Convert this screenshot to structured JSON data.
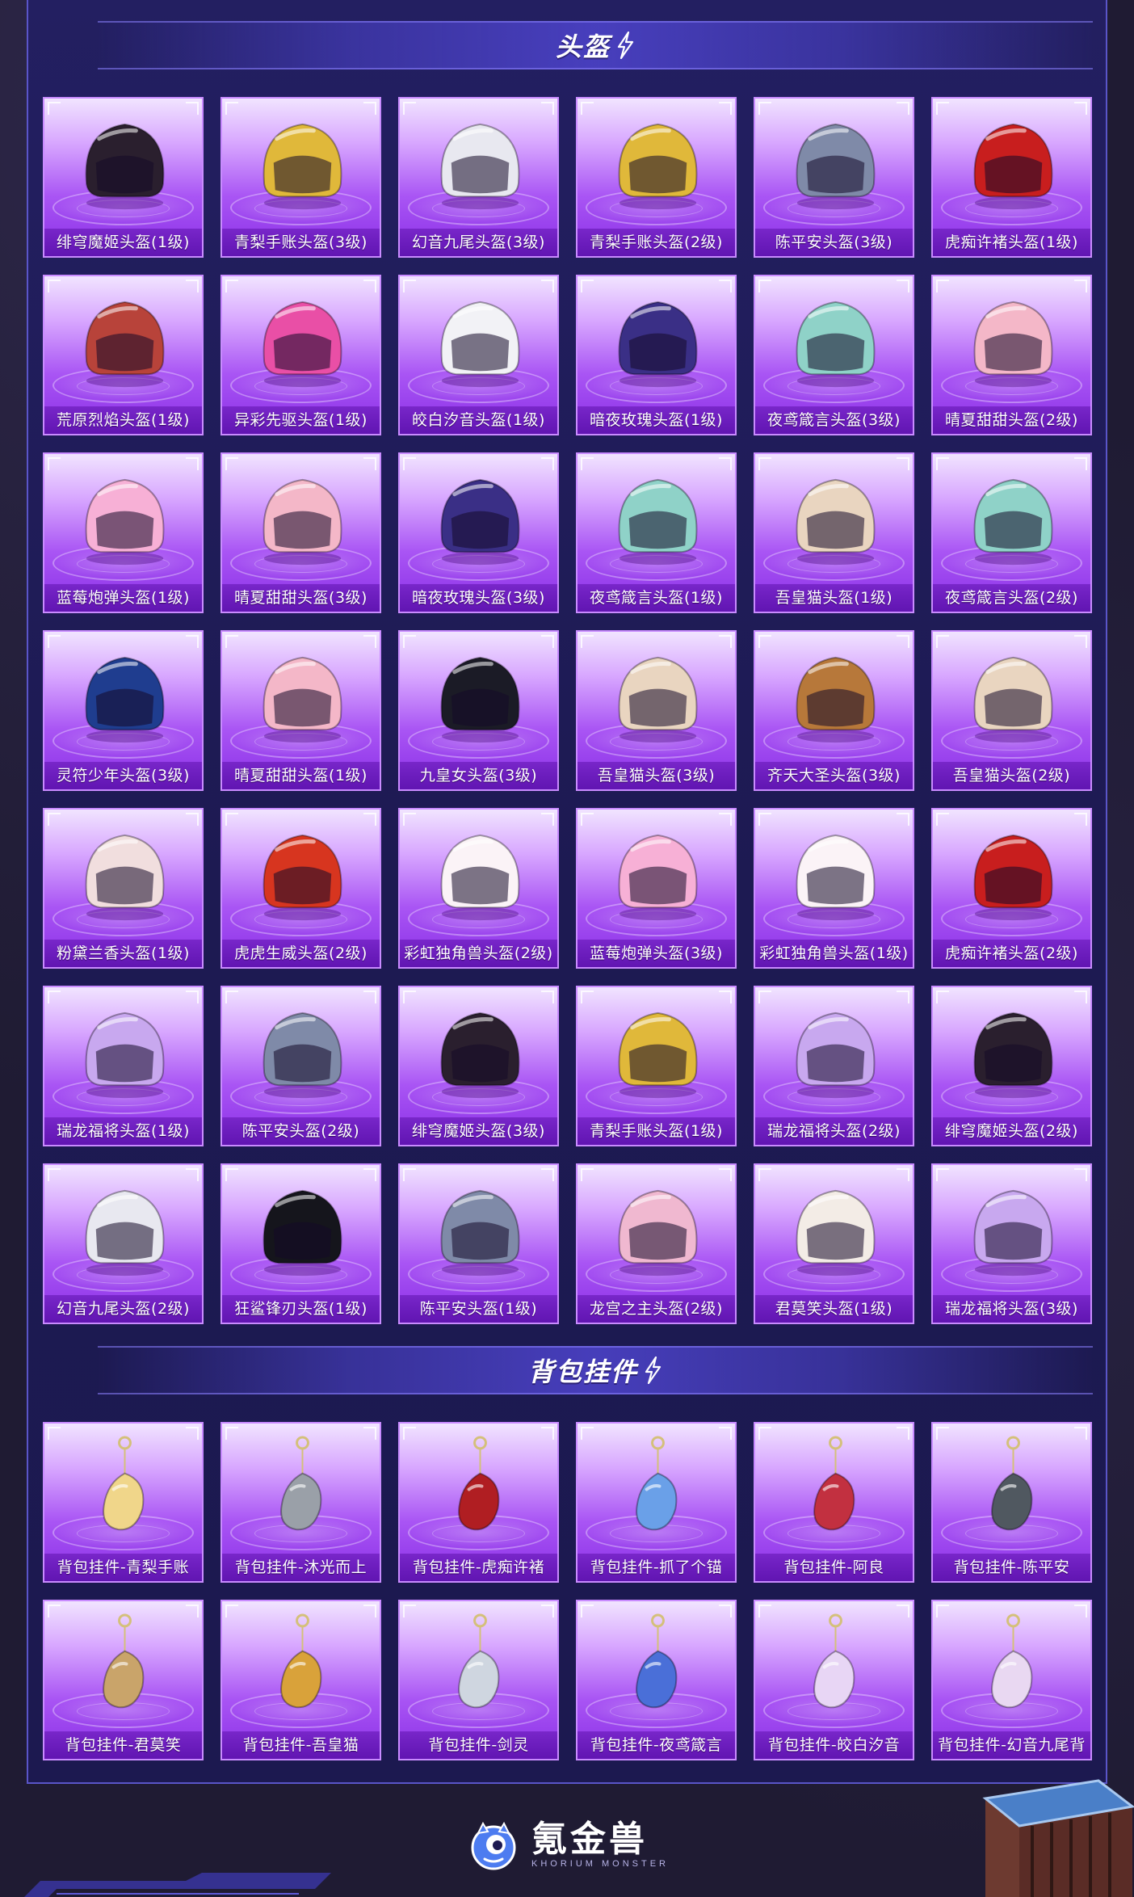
{
  "sections": [
    {
      "title": "头盔",
      "items": [
        {
          "label": "绯穹魔姬头盔(1级)",
          "icon": "helmet-icon",
          "color": "#2a1f2e"
        },
        {
          "label": "青梨手账头盔(3级)",
          "icon": "helmet-icon",
          "color": "#e0b83a"
        },
        {
          "label": "幻音九尾头盔(3级)",
          "icon": "helmet-icon",
          "color": "#e8e8f0"
        },
        {
          "label": "青梨手账头盔(2级)",
          "icon": "helmet-icon",
          "color": "#e0b83a"
        },
        {
          "label": "陈平安头盔(3级)",
          "icon": "helmet-icon",
          "color": "#7f8aa8"
        },
        {
          "label": "虎痴许褚头盔(1级)",
          "icon": "helmet-icon",
          "color": "#c81e1e"
        },
        {
          "label": "荒原烈焰头盔(1级)",
          "icon": "helmet-icon",
          "color": "#b8433a"
        },
        {
          "label": "异彩先驱头盔(1级)",
          "icon": "helmet-icon",
          "color": "#e94fa6"
        },
        {
          "label": "皎白汐音头盔(1级)",
          "icon": "helmet-icon",
          "color": "#f2f2f6"
        },
        {
          "label": "暗夜玫瑰头盔(1级)",
          "icon": "helmet-icon",
          "color": "#3a2f86"
        },
        {
          "label": "夜鸢箴言头盔(3级)",
          "icon": "helmet-icon",
          "color": "#8fd2c8"
        },
        {
          "label": "晴夏甜甜头盔(2级)",
          "icon": "helmet-icon",
          "color": "#f4b7c8"
        },
        {
          "label": "蓝莓炮弹头盔(1级)",
          "icon": "helmet-icon",
          "color": "#f7b0d6"
        },
        {
          "label": "晴夏甜甜头盔(3级)",
          "icon": "helmet-icon",
          "color": "#f4b7c8"
        },
        {
          "label": "暗夜玫瑰头盔(3级)",
          "icon": "helmet-icon",
          "color": "#3a2f86"
        },
        {
          "label": "夜鸢箴言头盔(1级)",
          "icon": "helmet-icon",
          "color": "#8fd2c8"
        },
        {
          "label": "吾皇猫头盔(1级)",
          "icon": "helmet-icon",
          "color": "#e9d5c0"
        },
        {
          "label": "夜鸢箴言头盔(2级)",
          "icon": "helmet-icon",
          "color": "#8fd2c8"
        },
        {
          "label": "灵符少年头盔(3级)",
          "icon": "helmet-icon",
          "color": "#1f3d8f"
        },
        {
          "label": "晴夏甜甜头盔(1级)",
          "icon": "helmet-icon",
          "color": "#f4b7c8"
        },
        {
          "label": "九皇女头盔(3级)",
          "icon": "helmet-icon",
          "color": "#1b1b26"
        },
        {
          "label": "吾皇猫头盔(3级)",
          "icon": "helmet-icon",
          "color": "#e9d5c0"
        },
        {
          "label": "齐天大圣头盔(3级)",
          "icon": "helmet-icon",
          "color": "#b7783a"
        },
        {
          "label": "吾皇猫头盔(2级)",
          "icon": "helmet-icon",
          "color": "#e9d5c0"
        },
        {
          "label": "粉黛兰香头盔(1级)",
          "icon": "helmet-icon",
          "color": "#f1dede"
        },
        {
          "label": "虎虎生威头盔(2级)",
          "icon": "helmet-icon",
          "color": "#d7351f"
        },
        {
          "label": "彩虹独角兽头盔(2级)",
          "icon": "helmet-icon",
          "color": "#fbf3f7"
        },
        {
          "label": "蓝莓炮弹头盔(3级)",
          "icon": "helmet-icon",
          "color": "#f7b0d6"
        },
        {
          "label": "彩虹独角兽头盔(1级)",
          "icon": "helmet-icon",
          "color": "#fbf3f7"
        },
        {
          "label": "虎痴许褚头盔(2级)",
          "icon": "helmet-icon",
          "color": "#c81e1e"
        },
        {
          "label": "瑞龙福将头盔(1级)",
          "icon": "helmet-icon",
          "color": "#c8a8ef"
        },
        {
          "label": "陈平安头盔(2级)",
          "icon": "helmet-icon",
          "color": "#7f8aa8"
        },
        {
          "label": "绯穹魔姬头盔(3级)",
          "icon": "helmet-icon",
          "color": "#2a1f2e"
        },
        {
          "label": "青梨手账头盔(1级)",
          "icon": "helmet-icon",
          "color": "#e0b83a"
        },
        {
          "label": "瑞龙福将头盔(2级)",
          "icon": "helmet-icon",
          "color": "#c8a8ef"
        },
        {
          "label": "绯穹魔姬头盔(2级)",
          "icon": "helmet-icon",
          "color": "#2a1f2e"
        },
        {
          "label": "幻音九尾头盔(2级)",
          "icon": "helmet-icon",
          "color": "#e8e8f0"
        },
        {
          "label": "狂鲨锋刃头盔(1级)",
          "icon": "helmet-icon",
          "color": "#15151c"
        },
        {
          "label": "陈平安头盔(1级)",
          "icon": "helmet-icon",
          "color": "#7f8aa8"
        },
        {
          "label": "龙宫之主头盔(2级)",
          "icon": "helmet-icon",
          "color": "#f0b8d0"
        },
        {
          "label": "君莫笑头盔(1级)",
          "icon": "helmet-icon",
          "color": "#f3ece6"
        },
        {
          "label": "瑞龙福将头盔(3级)",
          "icon": "helmet-icon",
          "color": "#c8a8ef"
        }
      ]
    },
    {
      "title": "背包挂件",
      "items": [
        {
          "label": "背包挂件-青梨手账",
          "icon": "pendant-icon",
          "color": "#f0d68a"
        },
        {
          "label": "背包挂件-沐光而上",
          "icon": "pendant-icon",
          "color": "#9aa0a8"
        },
        {
          "label": "背包挂件-虎痴许褚",
          "icon": "pendant-icon",
          "color": "#b01e22"
        },
        {
          "label": "背包挂件-抓了个锚",
          "icon": "pendant-icon",
          "color": "#6aa0e8"
        },
        {
          "label": "背包挂件-阿良",
          "icon": "pendant-icon",
          "color": "#c23040"
        },
        {
          "label": "背包挂件-陈平安",
          "icon": "pendant-icon",
          "color": "#505860"
        },
        {
          "label": "背包挂件-君莫笑",
          "icon": "pendant-icon",
          "color": "#c9a46a"
        },
        {
          "label": "背包挂件-吾皇猫",
          "icon": "pendant-icon",
          "color": "#d9a23a"
        },
        {
          "label": "背包挂件-剑灵",
          "icon": "pendant-icon",
          "color": "#cfd6e0"
        },
        {
          "label": "背包挂件-夜鸢箴言",
          "icon": "pendant-icon",
          "color": "#4a6fd8"
        },
        {
          "label": "背包挂件-皎白汐音",
          "icon": "pendant-icon",
          "color": "#e8d6f5"
        },
        {
          "label": "背包挂件-幻音九尾背",
          "icon": "pendant-icon",
          "color": "#e9d8f2"
        }
      ]
    }
  ],
  "footer": {
    "brand_name": "氪金兽",
    "brand_sub": "KHORIUM MONSTER",
    "mascot_icon": "monster-mascot-icon",
    "crate_icon": "supply-crate-icon"
  },
  "colors": {
    "panel": "#201d5c",
    "card_top": "#f1e4ff",
    "card_bottom": "#8a2fe6",
    "label_bg": "#6a1cb4",
    "accent": "#7b6cff"
  }
}
